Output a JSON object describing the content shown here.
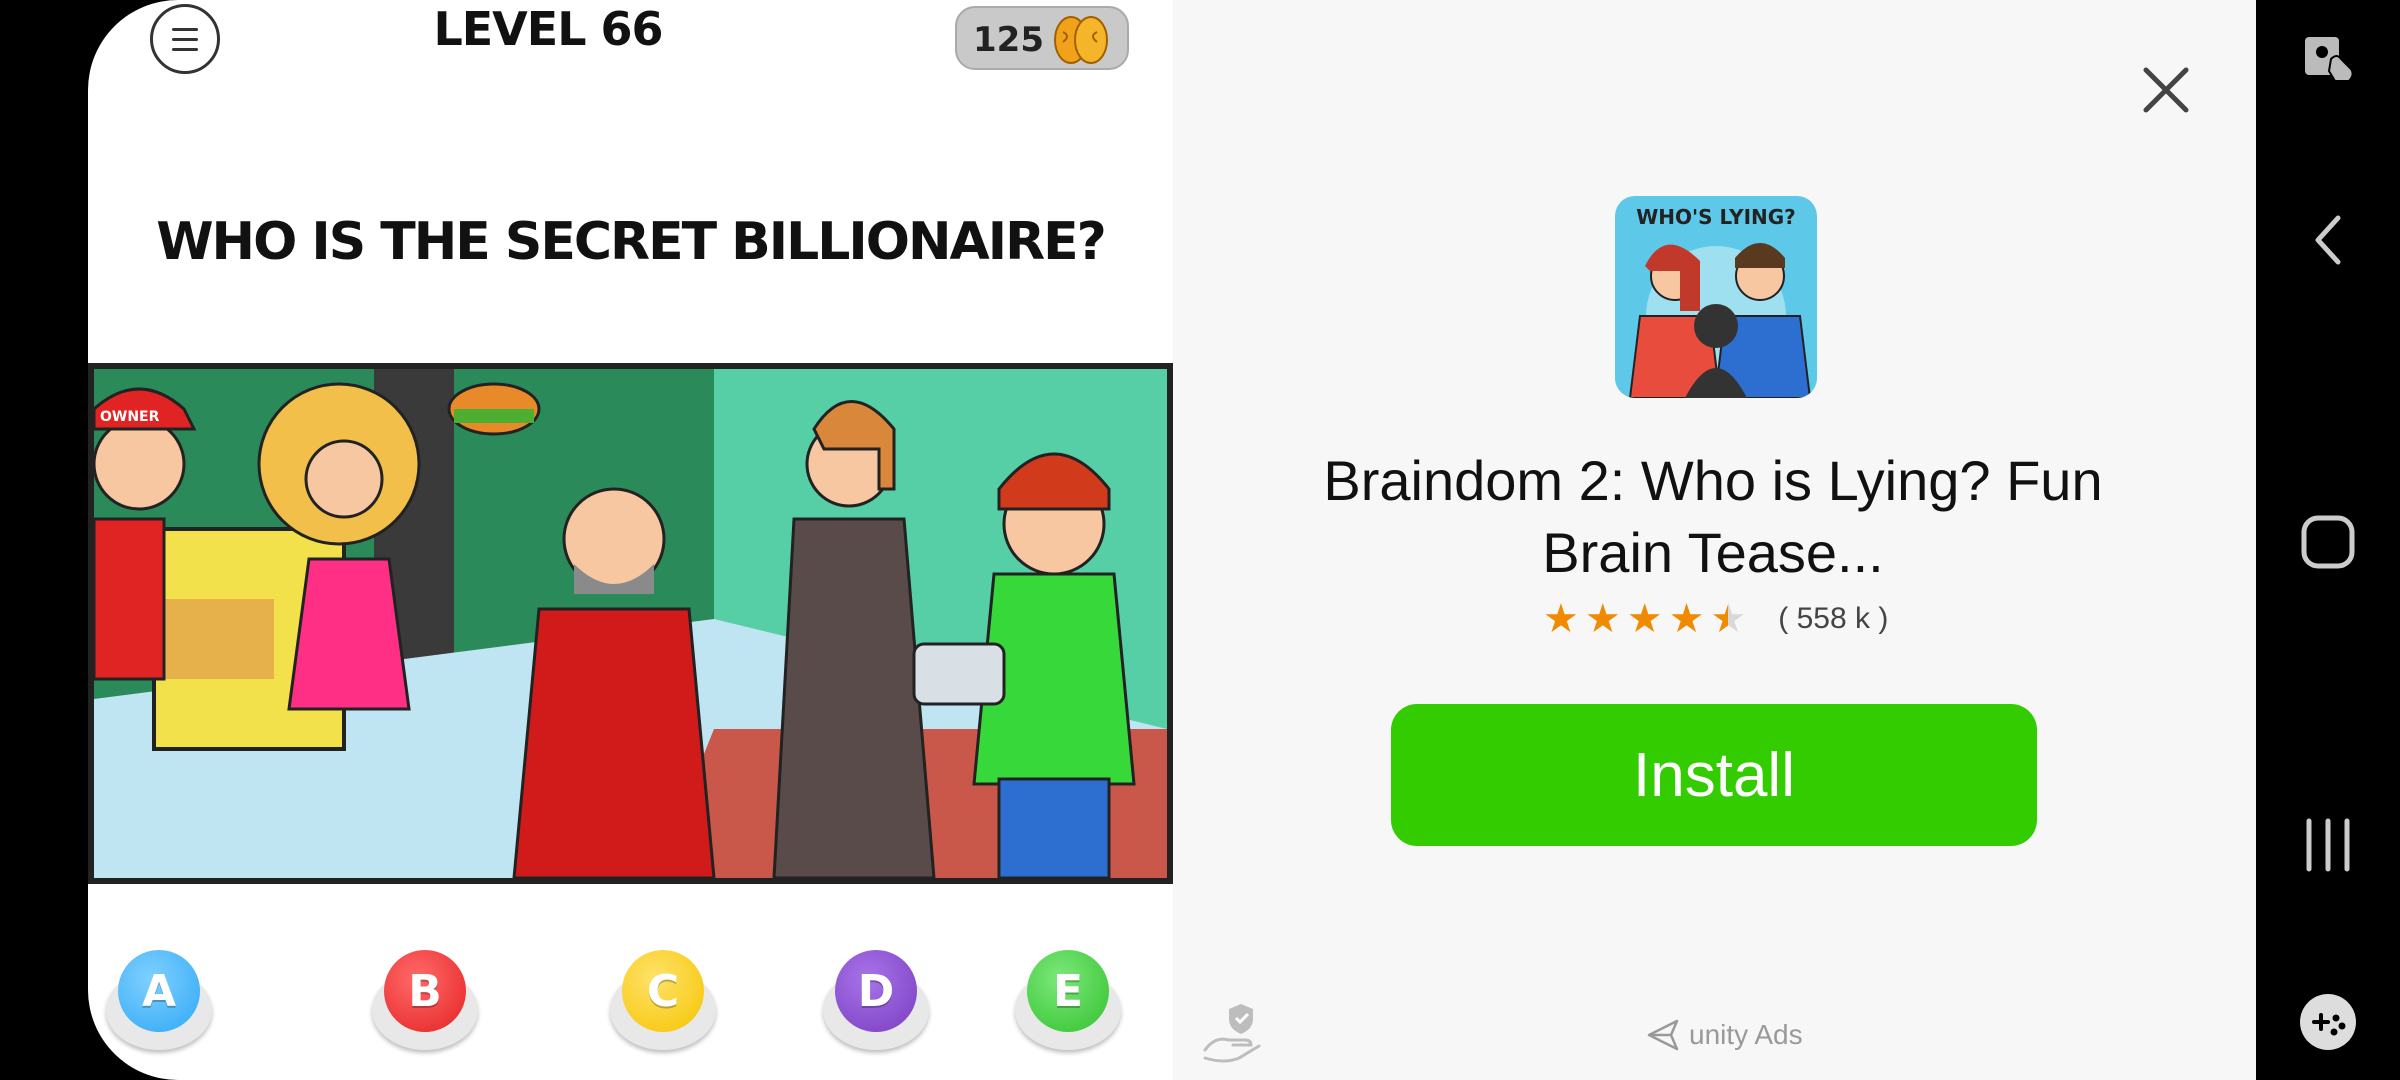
{
  "game": {
    "level": "LEVEL 66",
    "coins": "125",
    "question": "WHO IS THE SECRET BILLIONAIRE?",
    "scene_sign": "OWNER",
    "answers": [
      {
        "label": "A",
        "color": "#2fa8f5"
      },
      {
        "label": "B",
        "color": "#e52222"
      },
      {
        "label": "C",
        "color": "#f5c400"
      },
      {
        "label": "D",
        "color": "#7a3cc2"
      },
      {
        "label": "E",
        "color": "#33c12f"
      }
    ]
  },
  "ad": {
    "app_icon_text": "WHO'S LYING?",
    "app_title": "Braindom 2: Who is Lying? Fun Brain Tease...",
    "rating": 4.5,
    "rating_count": "( 558 k )",
    "install_label": "Install",
    "install_color": "#33cc00",
    "brand": "unity Ads"
  }
}
